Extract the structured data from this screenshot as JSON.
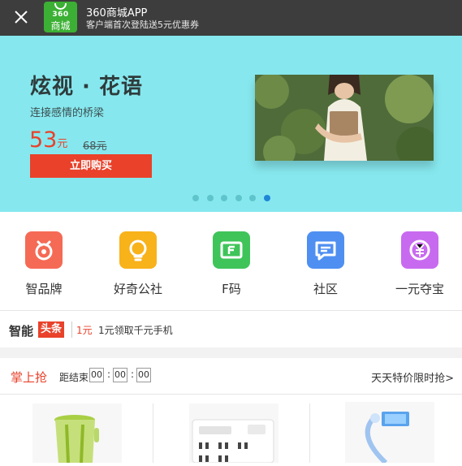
{
  "app_bar": {
    "title": "360商城APP",
    "subtitle": "客户端首次登陆送5元优惠券",
    "logo_line1": "360",
    "logo_line2": "商城"
  },
  "banner": {
    "title": "炫视 · 花语",
    "subtitle": "连接感情的桥梁",
    "price": "53",
    "price_unit": "元",
    "old_price": "68元",
    "buy_label": "立即购买",
    "slide_count": 6,
    "active_slide": 6
  },
  "nav": [
    {
      "label": "智品牌",
      "color": "#f56a55"
    },
    {
      "label": "好奇公社",
      "color": "#f8b21a"
    },
    {
      "label": "F码",
      "color": "#3fc45a"
    },
    {
      "label": "社区",
      "color": "#4f8ff1"
    },
    {
      "label": "一元夺宝",
      "color": "#c86af0"
    }
  ],
  "news": {
    "brand_part1": "智能",
    "brand_part2": "头条",
    "tag": "1元",
    "text": "1元领取千元手机"
  },
  "flash": {
    "title": "掌上抢",
    "countdown_label": "距结束",
    "hours": "00",
    "minutes": "00",
    "seconds": "00",
    "more": "天天特价限时抢",
    "more_arrow": ">"
  },
  "colors": {
    "accent": "#e9412a",
    "banner_bg": "#86e8ee",
    "appbar_bg": "#3d3d3d",
    "logo_green": "#3cb034"
  }
}
